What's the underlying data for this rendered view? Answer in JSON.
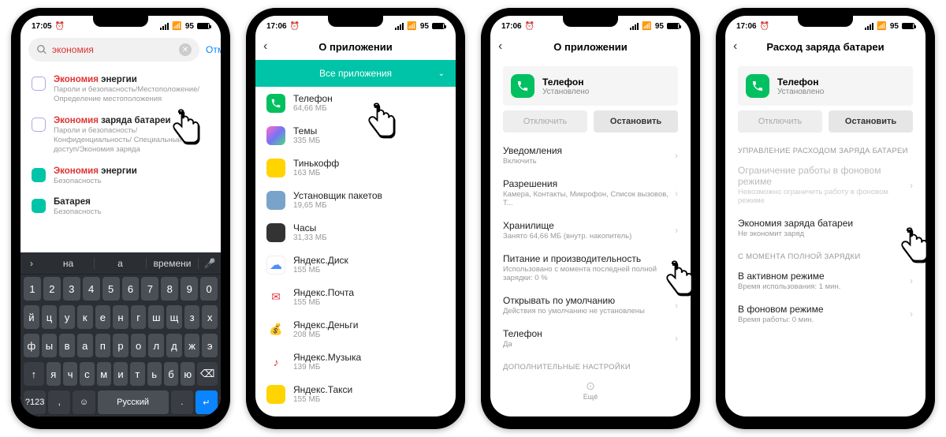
{
  "status": {
    "time1": "17:05",
    "time2": "17:06",
    "alarm": "⏰",
    "network": "95",
    "batt_pct": "95"
  },
  "screen1": {
    "search_value": "экономия",
    "cancel": "Отмена",
    "results": [
      {
        "highlight": "Экономия",
        "rest": " энергии",
        "sub": "Пароли и безопасность/Местоположение/ Определение местоположения",
        "ico_bg": "#fff",
        "ico_border": "#b6a3e6"
      },
      {
        "highlight": "Экономия",
        "rest": " заряда батареи",
        "sub": "Пароли и безопасность/Конфиденциальность/ Специальный доступ/Экономия заряда",
        "ico_bg": "#fff",
        "ico_border": "#b6a3e6"
      },
      {
        "highlight": "Экономия",
        "rest": " энергии",
        "sub": "Безопасность",
        "ico_bg": "#00c4a7"
      },
      {
        "highlight": "",
        "rest": "Батарея",
        "sub": "Безопасность",
        "ico_bg": "#00c4a7"
      }
    ],
    "suggestions": [
      "на",
      "а",
      "времени"
    ],
    "kbd": {
      "row1": [
        "1",
        "2",
        "3",
        "4",
        "5",
        "6",
        "7",
        "8",
        "9",
        "0"
      ],
      "row2": [
        "й",
        "ц",
        "у",
        "к",
        "е",
        "н",
        "г",
        "ш",
        "щ",
        "з",
        "х"
      ],
      "row3": [
        "ф",
        "ы",
        "в",
        "а",
        "п",
        "р",
        "о",
        "л",
        "д",
        "ж",
        "э"
      ],
      "row4": [
        "↑",
        "я",
        "ч",
        "с",
        "м",
        "и",
        "т",
        "ь",
        "б",
        "ю",
        "⌫"
      ],
      "row5_lang": "Русский",
      "row5_sym": "?123",
      "row5_comma": ",",
      "row5_dot": ".",
      "row5_enter": "↵"
    }
  },
  "screen2": {
    "title": "О приложении",
    "dropdown": "Все приложения",
    "apps": [
      {
        "name": "Телефон",
        "size": "64,66 МБ",
        "bg": "#00c060",
        "glyph": "phone"
      },
      {
        "name": "Темы",
        "size": "335 МБ",
        "bg": "linear-gradient(135deg,#ff6ec7,#7873f5,#4ade80)"
      },
      {
        "name": "Тинькофф",
        "size": "163 МБ",
        "bg": "#ffd400",
        "fg": "#222"
      },
      {
        "name": "Установщик пакетов",
        "size": "19,65 МБ",
        "bg": "#7aa3c9"
      },
      {
        "name": "Часы",
        "size": "31,33 МБ",
        "bg": "#333"
      },
      {
        "name": "Яндекс.Диск",
        "size": "155 МБ",
        "bg": "#fff",
        "border": "#eee",
        "glyph": "ydisk"
      },
      {
        "name": "Яндекс.Почта",
        "size": "155 МБ",
        "bg": "#fff",
        "glyph": "ymail"
      },
      {
        "name": "Яндекс.Деньги",
        "size": "208 МБ",
        "bg": "#fff",
        "glyph": "ymoney"
      },
      {
        "name": "Яндекс.Музыка",
        "size": "139 МБ",
        "bg": "#fff",
        "glyph": "ymusic"
      },
      {
        "name": "Яндекс.Такси",
        "size": "155 МБ",
        "bg": "#ffd400"
      }
    ]
  },
  "screen3": {
    "title": "О приложении",
    "app": {
      "name": "Телефон",
      "status": "Установлено"
    },
    "btn_off": "Отключить",
    "btn_stop": "Остановить",
    "rows": [
      {
        "title": "Уведомления",
        "sub": "Включить"
      },
      {
        "title": "Разрешения",
        "sub": "Камера, Контакты, Микрофон, Список вызовов, Т..."
      },
      {
        "title": "Хранилище",
        "sub": "Занято 64,66 МБ (внутр. накопитель)"
      },
      {
        "title": "Питание и производительность",
        "sub": "Использовано с момента последней полной зарядки: 0 %"
      },
      {
        "title": "Открывать по умолчанию",
        "sub": "Действия по умолчанию не установлены"
      },
      {
        "title": "Телефон",
        "sub": "Да"
      }
    ],
    "footer_label": "ДОПОЛНИТЕЛЬНЫЕ НАСТРОЙКИ",
    "more": "Ещё"
  },
  "screen4": {
    "title": "Расход заряда батареи",
    "app": {
      "name": "Телефон",
      "status": "Установлено"
    },
    "btn_off": "Отключить",
    "btn_stop": "Остановить",
    "label1": "УПРАВЛЕНИЕ РАСХОДОМ ЗАРЯДА БАТАРЕИ",
    "row_bg": {
      "title": "Ограничение работы в фоновом режиме",
      "sub": "Невозможно ограничить работу в фоновом режиме"
    },
    "row_eco": {
      "title": "Экономия заряда батареи",
      "sub": "Не экономит заряд"
    },
    "label2": "С МОМЕНТА ПОЛНОЙ ЗАРЯДКИ",
    "row_active": {
      "title": "В активном режиме",
      "sub": "Время использования: 1 мин."
    },
    "row_bgtime": {
      "title": "В фоновом режиме",
      "sub": "Время работы: 0 мин."
    }
  }
}
